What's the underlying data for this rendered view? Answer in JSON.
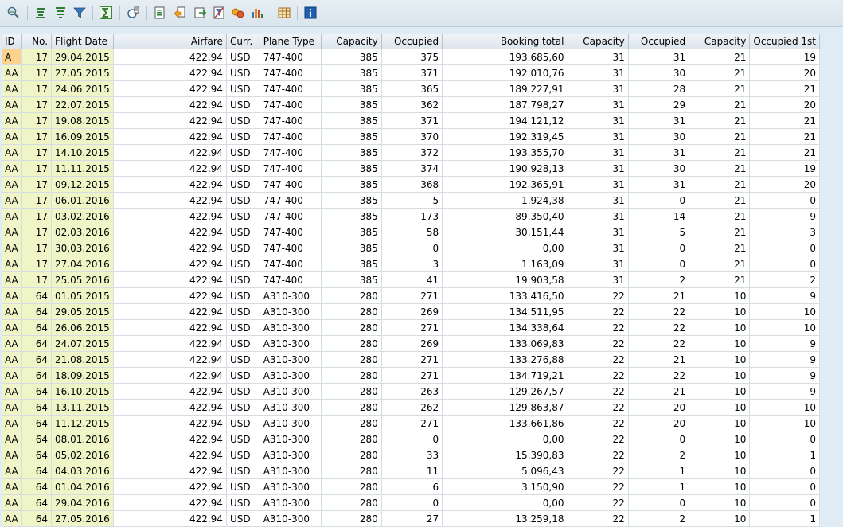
{
  "toolbar": {
    "buttons": [
      {
        "name": "details-icon"
      },
      {
        "name": "sort-ascending-icon"
      },
      {
        "name": "sort-descending-icon"
      },
      {
        "name": "filter-icon"
      },
      {
        "name": "total-icon"
      },
      {
        "name": "subtotal-icon"
      },
      {
        "name": "export-spreadsheet-icon"
      },
      {
        "name": "change-layout-icon"
      },
      {
        "name": "select-layout-icon"
      },
      {
        "name": "delete-filter-icon"
      },
      {
        "name": "view-icon"
      },
      {
        "name": "graphic-icon"
      },
      {
        "name": "grid-layout-icon"
      },
      {
        "name": "info-icon"
      }
    ]
  },
  "table": {
    "columns": [
      "ID",
      "No.",
      "Flight Date",
      "Airfare",
      "Curr.",
      "Plane Type",
      "Capacity",
      "Occupied",
      "Booking total",
      "Capacity",
      "Occupied",
      "Capacity",
      "Occupied 1st"
    ],
    "rows": [
      [
        "A",
        "17",
        "29.04.2015",
        "422,94",
        "USD",
        "747-400",
        "385",
        "375",
        "193.685,60",
        "31",
        "31",
        "21",
        "19"
      ],
      [
        "AA",
        "17",
        "27.05.2015",
        "422,94",
        "USD",
        "747-400",
        "385",
        "371",
        "192.010,76",
        "31",
        "30",
        "21",
        "20"
      ],
      [
        "AA",
        "17",
        "24.06.2015",
        "422,94",
        "USD",
        "747-400",
        "385",
        "365",
        "189.227,91",
        "31",
        "28",
        "21",
        "21"
      ],
      [
        "AA",
        "17",
        "22.07.2015",
        "422,94",
        "USD",
        "747-400",
        "385",
        "362",
        "187.798,27",
        "31",
        "29",
        "21",
        "20"
      ],
      [
        "AA",
        "17",
        "19.08.2015",
        "422,94",
        "USD",
        "747-400",
        "385",
        "371",
        "194.121,12",
        "31",
        "31",
        "21",
        "21"
      ],
      [
        "AA",
        "17",
        "16.09.2015",
        "422,94",
        "USD",
        "747-400",
        "385",
        "370",
        "192.319,45",
        "31",
        "30",
        "21",
        "21"
      ],
      [
        "AA",
        "17",
        "14.10.2015",
        "422,94",
        "USD",
        "747-400",
        "385",
        "372",
        "193.355,70",
        "31",
        "31",
        "21",
        "21"
      ],
      [
        "AA",
        "17",
        "11.11.2015",
        "422,94",
        "USD",
        "747-400",
        "385",
        "374",
        "190.928,13",
        "31",
        "30",
        "21",
        "19"
      ],
      [
        "AA",
        "17",
        "09.12.2015",
        "422,94",
        "USD",
        "747-400",
        "385",
        "368",
        "192.365,91",
        "31",
        "31",
        "21",
        "20"
      ],
      [
        "AA",
        "17",
        "06.01.2016",
        "422,94",
        "USD",
        "747-400",
        "385",
        "5",
        "1.924,38",
        "31",
        "0",
        "21",
        "0"
      ],
      [
        "AA",
        "17",
        "03.02.2016",
        "422,94",
        "USD",
        "747-400",
        "385",
        "173",
        "89.350,40",
        "31",
        "14",
        "21",
        "9"
      ],
      [
        "AA",
        "17",
        "02.03.2016",
        "422,94",
        "USD",
        "747-400",
        "385",
        "58",
        "30.151,44",
        "31",
        "5",
        "21",
        "3"
      ],
      [
        "AA",
        "17",
        "30.03.2016",
        "422,94",
        "USD",
        "747-400",
        "385",
        "0",
        "0,00",
        "31",
        "0",
        "21",
        "0"
      ],
      [
        "AA",
        "17",
        "27.04.2016",
        "422,94",
        "USD",
        "747-400",
        "385",
        "3",
        "1.163,09",
        "31",
        "0",
        "21",
        "0"
      ],
      [
        "AA",
        "17",
        "25.05.2016",
        "422,94",
        "USD",
        "747-400",
        "385",
        "41",
        "19.903,58",
        "31",
        "2",
        "21",
        "2"
      ],
      [
        "AA",
        "64",
        "01.05.2015",
        "422,94",
        "USD",
        "A310-300",
        "280",
        "271",
        "133.416,50",
        "22",
        "21",
        "10",
        "9"
      ],
      [
        "AA",
        "64",
        "29.05.2015",
        "422,94",
        "USD",
        "A310-300",
        "280",
        "269",
        "134.511,95",
        "22",
        "22",
        "10",
        "10"
      ],
      [
        "AA",
        "64",
        "26.06.2015",
        "422,94",
        "USD",
        "A310-300",
        "280",
        "271",
        "134.338,64",
        "22",
        "22",
        "10",
        "10"
      ],
      [
        "AA",
        "64",
        "24.07.2015",
        "422,94",
        "USD",
        "A310-300",
        "280",
        "269",
        "133.069,83",
        "22",
        "22",
        "10",
        "9"
      ],
      [
        "AA",
        "64",
        "21.08.2015",
        "422,94",
        "USD",
        "A310-300",
        "280",
        "271",
        "133.276,88",
        "22",
        "21",
        "10",
        "9"
      ],
      [
        "AA",
        "64",
        "18.09.2015",
        "422,94",
        "USD",
        "A310-300",
        "280",
        "271",
        "134.719,21",
        "22",
        "22",
        "10",
        "9"
      ],
      [
        "AA",
        "64",
        "16.10.2015",
        "422,94",
        "USD",
        "A310-300",
        "280",
        "263",
        "129.267,57",
        "22",
        "21",
        "10",
        "9"
      ],
      [
        "AA",
        "64",
        "13.11.2015",
        "422,94",
        "USD",
        "A310-300",
        "280",
        "262",
        "129.863,87",
        "22",
        "20",
        "10",
        "10"
      ],
      [
        "AA",
        "64",
        "11.12.2015",
        "422,94",
        "USD",
        "A310-300",
        "280",
        "271",
        "133.661,86",
        "22",
        "20",
        "10",
        "10"
      ],
      [
        "AA",
        "64",
        "08.01.2016",
        "422,94",
        "USD",
        "A310-300",
        "280",
        "0",
        "0,00",
        "22",
        "0",
        "10",
        "0"
      ],
      [
        "AA",
        "64",
        "05.02.2016",
        "422,94",
        "USD",
        "A310-300",
        "280",
        "33",
        "15.390,83",
        "22",
        "2",
        "10",
        "1"
      ],
      [
        "AA",
        "64",
        "04.03.2016",
        "422,94",
        "USD",
        "A310-300",
        "280",
        "11",
        "5.096,43",
        "22",
        "1",
        "10",
        "0"
      ],
      [
        "AA",
        "64",
        "01.04.2016",
        "422,94",
        "USD",
        "A310-300",
        "280",
        "6",
        "3.150,90",
        "22",
        "1",
        "10",
        "0"
      ],
      [
        "AA",
        "64",
        "29.04.2016",
        "422,94",
        "USD",
        "A310-300",
        "280",
        "0",
        "0,00",
        "22",
        "0",
        "10",
        "0"
      ],
      [
        "AA",
        "64",
        "27.05.2016",
        "422,94",
        "USD",
        "A310-300",
        "280",
        "27",
        "13.259,18",
        "22",
        "2",
        "10",
        "1"
      ]
    ]
  },
  "colors": {
    "key_cell": "#eff5c6",
    "selected_cell": "#fcd28c",
    "background": "#dfebf5"
  }
}
